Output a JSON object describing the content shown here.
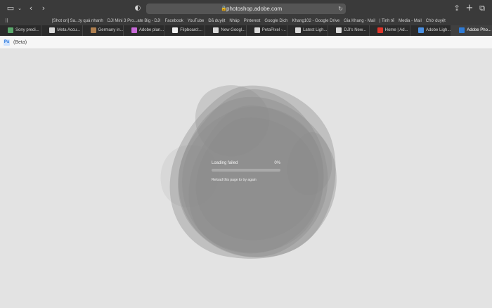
{
  "browser": {
    "url": "photoshop.adobe.com",
    "favorites": [
      "[Shot on] Sa...ty quá nhanh",
      "DJI Mini 3 Pro...ate Big - DJI",
      "Facebook",
      "YouTube",
      "Đã duyệt",
      "Nháp",
      "Pinterest",
      "Google Dịch",
      "Khang102 - Google Drive",
      "Gia Khang - Mail",
      "| Tinh tế",
      "Media - Mail",
      "Chờ duyệt"
    ],
    "tabs": [
      {
        "label": "Sony predi...",
        "icon_color": "#5aa86b"
      },
      {
        "label": "Meta Accu...",
        "icon_color": "#d9d9d9"
      },
      {
        "label": "Germany in...",
        "icon_color": "#b08050"
      },
      {
        "label": "Adobe plan...",
        "icon_color": "#c86ad8"
      },
      {
        "label": "Flipboard:...",
        "icon_color": "#f0f0f0"
      },
      {
        "label": "New Googl...",
        "icon_color": "#d9d9d9"
      },
      {
        "label": "PetaPixel -...",
        "icon_color": "#d9d9d9"
      },
      {
        "label": "Latest Ligh...",
        "icon_color": "#d9d9d9"
      },
      {
        "label": "DJI's New...",
        "icon_color": "#d9d9d9"
      },
      {
        "label": "Home | Ad...",
        "icon_color": "#e0352b"
      },
      {
        "label": "Adobe Ligh...",
        "icon_color": "#4a90e2"
      },
      {
        "label": "Adobe Pho...",
        "icon_color": "#2e7bd6"
      }
    ]
  },
  "app": {
    "logo": "Ps",
    "badge": "(Beta)"
  },
  "loader": {
    "status": "Loading failed",
    "percent": "0%",
    "progress": 0,
    "hint": "Reload this page to try again"
  },
  "colors": {
    "toolbar": "#3a3a3a",
    "tabbar": "#2b2b2b",
    "page_bg": "#e3e3e3",
    "blob": "#8c8c8c"
  }
}
